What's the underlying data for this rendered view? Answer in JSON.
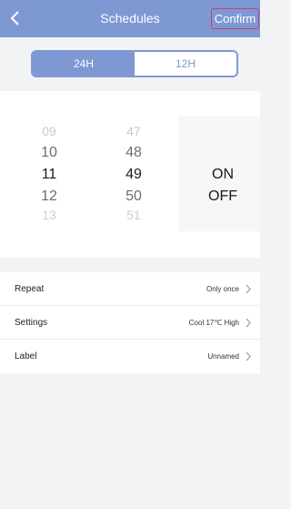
{
  "header": {
    "title": "Schedules",
    "confirm_label": "Confirm"
  },
  "time_format": {
    "options": [
      "24H",
      "12H"
    ],
    "selected": "24H"
  },
  "picker": {
    "hours": [
      "09",
      "10",
      "11",
      "12",
      "13"
    ],
    "minutes": [
      "47",
      "48",
      "49",
      "50",
      "51"
    ],
    "modes": [
      "ON",
      "OFF"
    ],
    "selected_hour": "11",
    "selected_minute": "49",
    "selected_mode": "ON"
  },
  "settings": {
    "rows": [
      {
        "label": "Repeat",
        "value": "Only once"
      },
      {
        "label": "Settings",
        "value": "Cool 17℃ High"
      },
      {
        "label": "Label",
        "value": "Unnamed"
      }
    ]
  },
  "colors": {
    "accent": "#7e98d3",
    "confirm_border": "#c0437a",
    "background": "#f2f3f5"
  }
}
